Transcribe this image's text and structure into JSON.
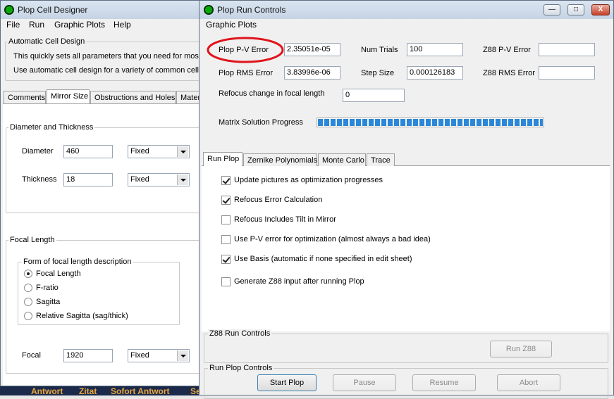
{
  "taskbar": {
    "items": [
      "Antwort",
      "Zitat",
      "Sofort Antwort",
      "Se"
    ]
  },
  "cell_designer": {
    "title": "Plop Cell Designer",
    "menu": [
      "File",
      "Run",
      "Graphic Plots",
      "Help"
    ],
    "auto_group": {
      "label": "Automatic Cell Design",
      "line1": "This quickly sets all parameters that you need for most c",
      "line2": "Use automatic cell design for a variety of common cell c"
    },
    "tabs": [
      "Comments",
      "Mirror Size",
      "Obstructions and Holes",
      "Mater"
    ],
    "active_tab": "Mirror Size",
    "diam_group": {
      "label": "Diameter and Thickness",
      "diameter_label": "Diameter",
      "diameter_value": "460",
      "diameter_mode": "Fixed",
      "thickness_label": "Thickness",
      "thickness_value": "18",
      "thickness_mode": "Fixed"
    },
    "focal_group": {
      "label": "Focal Length",
      "form_label": "Form of focal length description",
      "options": [
        "Focal Length",
        "F-ratio",
        "Sagitta",
        "Relative Sagitta (sag/thick)"
      ],
      "selected": "Focal Length",
      "focal_label": "Focal",
      "focal_value": "1920",
      "focal_mode": "Fixed"
    }
  },
  "run_controls": {
    "title": "Plop Run Controls",
    "caption_buttons": {
      "minimize": "—",
      "maximize": "□",
      "close": "X"
    },
    "menu": [
      "Graphic Plots"
    ],
    "fields": {
      "pv_error_label": "Plop P-V Error",
      "pv_error_value": "2.35051e-05",
      "rms_error_label": "Plop RMS Error",
      "rms_error_value": "3.83996e-06",
      "num_trials_label": "Num Trials",
      "num_trials_value": "100",
      "step_size_label": "Step Size",
      "step_size_value": "0.000126183",
      "z88_pv_label": "Z88 P-V Error",
      "z88_pv_value": "",
      "z88_rms_label": "Z88 RMS Error",
      "z88_rms_value": "",
      "refocus_label": "Refocus change in focal length",
      "refocus_value": "0"
    },
    "progress": {
      "label": "Matrix Solution Progress",
      "fraction": 1.0
    },
    "highlight_color": "#e0141c",
    "tabs": [
      "Run Plop",
      "Zernike Polynomials",
      "Monte Carlo",
      "Trace"
    ],
    "active_tab": "Run Plop",
    "options": [
      {
        "label": "Update pictures as optimization progresses",
        "checked": true
      },
      {
        "label": "Refocus Error Calculation",
        "checked": true
      },
      {
        "label": "Refocus Includes Tilt in Mirror",
        "checked": false
      },
      {
        "label": "Use P-V error for optimization (almost always a bad idea)",
        "checked": false
      },
      {
        "label": "Use Basis (automatic if none specified in edit sheet)",
        "checked": true
      },
      {
        "label": "Generate Z88 input after running Plop",
        "checked": false
      }
    ],
    "z88_group": {
      "label": "Z88 Run Controls",
      "run_button": "Run Z88"
    },
    "plop_group": {
      "label": "Run Plop Controls",
      "start": "Start Plop",
      "pause": "Pause",
      "resume": "Resume",
      "abort": "Abort"
    }
  }
}
